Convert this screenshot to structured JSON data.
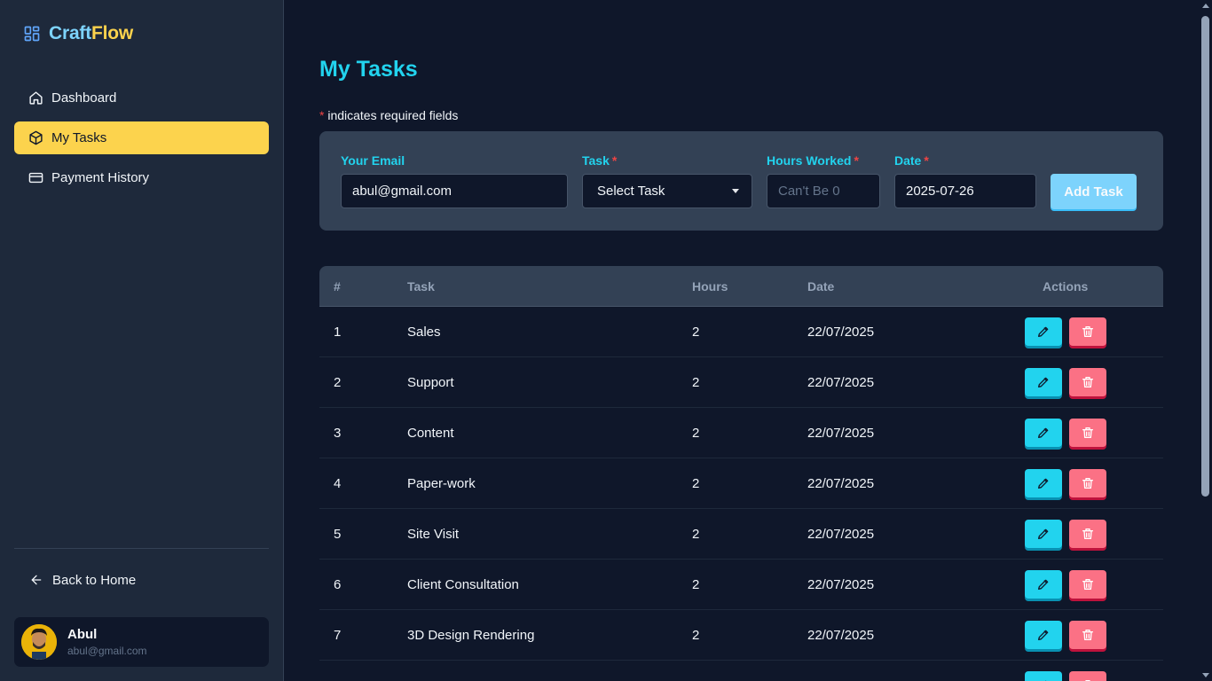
{
  "brand": {
    "name_part1": "Craft",
    "name_part2": "Flow",
    "icon": "dashboard-grid-icon"
  },
  "sidebar": {
    "items": [
      {
        "label": "Dashboard",
        "icon": "home-icon",
        "active": false
      },
      {
        "label": "My Tasks",
        "icon": "cube-icon",
        "active": true
      },
      {
        "label": "Payment History",
        "icon": "credit-card-icon",
        "active": false
      }
    ],
    "back_home": "Back to Home",
    "user": {
      "name": "Abul",
      "email": "abul@gmail.com"
    }
  },
  "main": {
    "title": "My Tasks",
    "required_star": "*",
    "required_note": " indicates required fields",
    "form": {
      "email_label": "Your Email",
      "email_value": "abul@gmail.com",
      "task_label": "Task",
      "task_value": "Select Task",
      "hours_label": "Hours Worked",
      "hours_placeholder": "Can't Be 0",
      "date_label": "Date",
      "date_value": "2025-07-26",
      "submit_label": "Add Task"
    },
    "table": {
      "headers": [
        "#",
        "Task",
        "Hours",
        "Date",
        "Actions"
      ],
      "rows": [
        {
          "num": "1",
          "task": "Sales",
          "hours": "2",
          "date": "22/07/2025"
        },
        {
          "num": "2",
          "task": "Support",
          "hours": "2",
          "date": "22/07/2025"
        },
        {
          "num": "3",
          "task": "Content",
          "hours": "2",
          "date": "22/07/2025"
        },
        {
          "num": "4",
          "task": "Paper-work",
          "hours": "2",
          "date": "22/07/2025"
        },
        {
          "num": "5",
          "task": "Site Visit",
          "hours": "2",
          "date": "22/07/2025"
        },
        {
          "num": "6",
          "task": "Client Consultation",
          "hours": "2",
          "date": "22/07/2025"
        },
        {
          "num": "7",
          "task": "3D Design Rendering",
          "hours": "2",
          "date": "22/07/2025"
        }
      ]
    }
  },
  "colors": {
    "accent_cyan": "#22d3ee",
    "accent_yellow": "#fcd34d",
    "danger": "#fb7185",
    "background": "#0f172a",
    "panel": "#1e293b"
  }
}
